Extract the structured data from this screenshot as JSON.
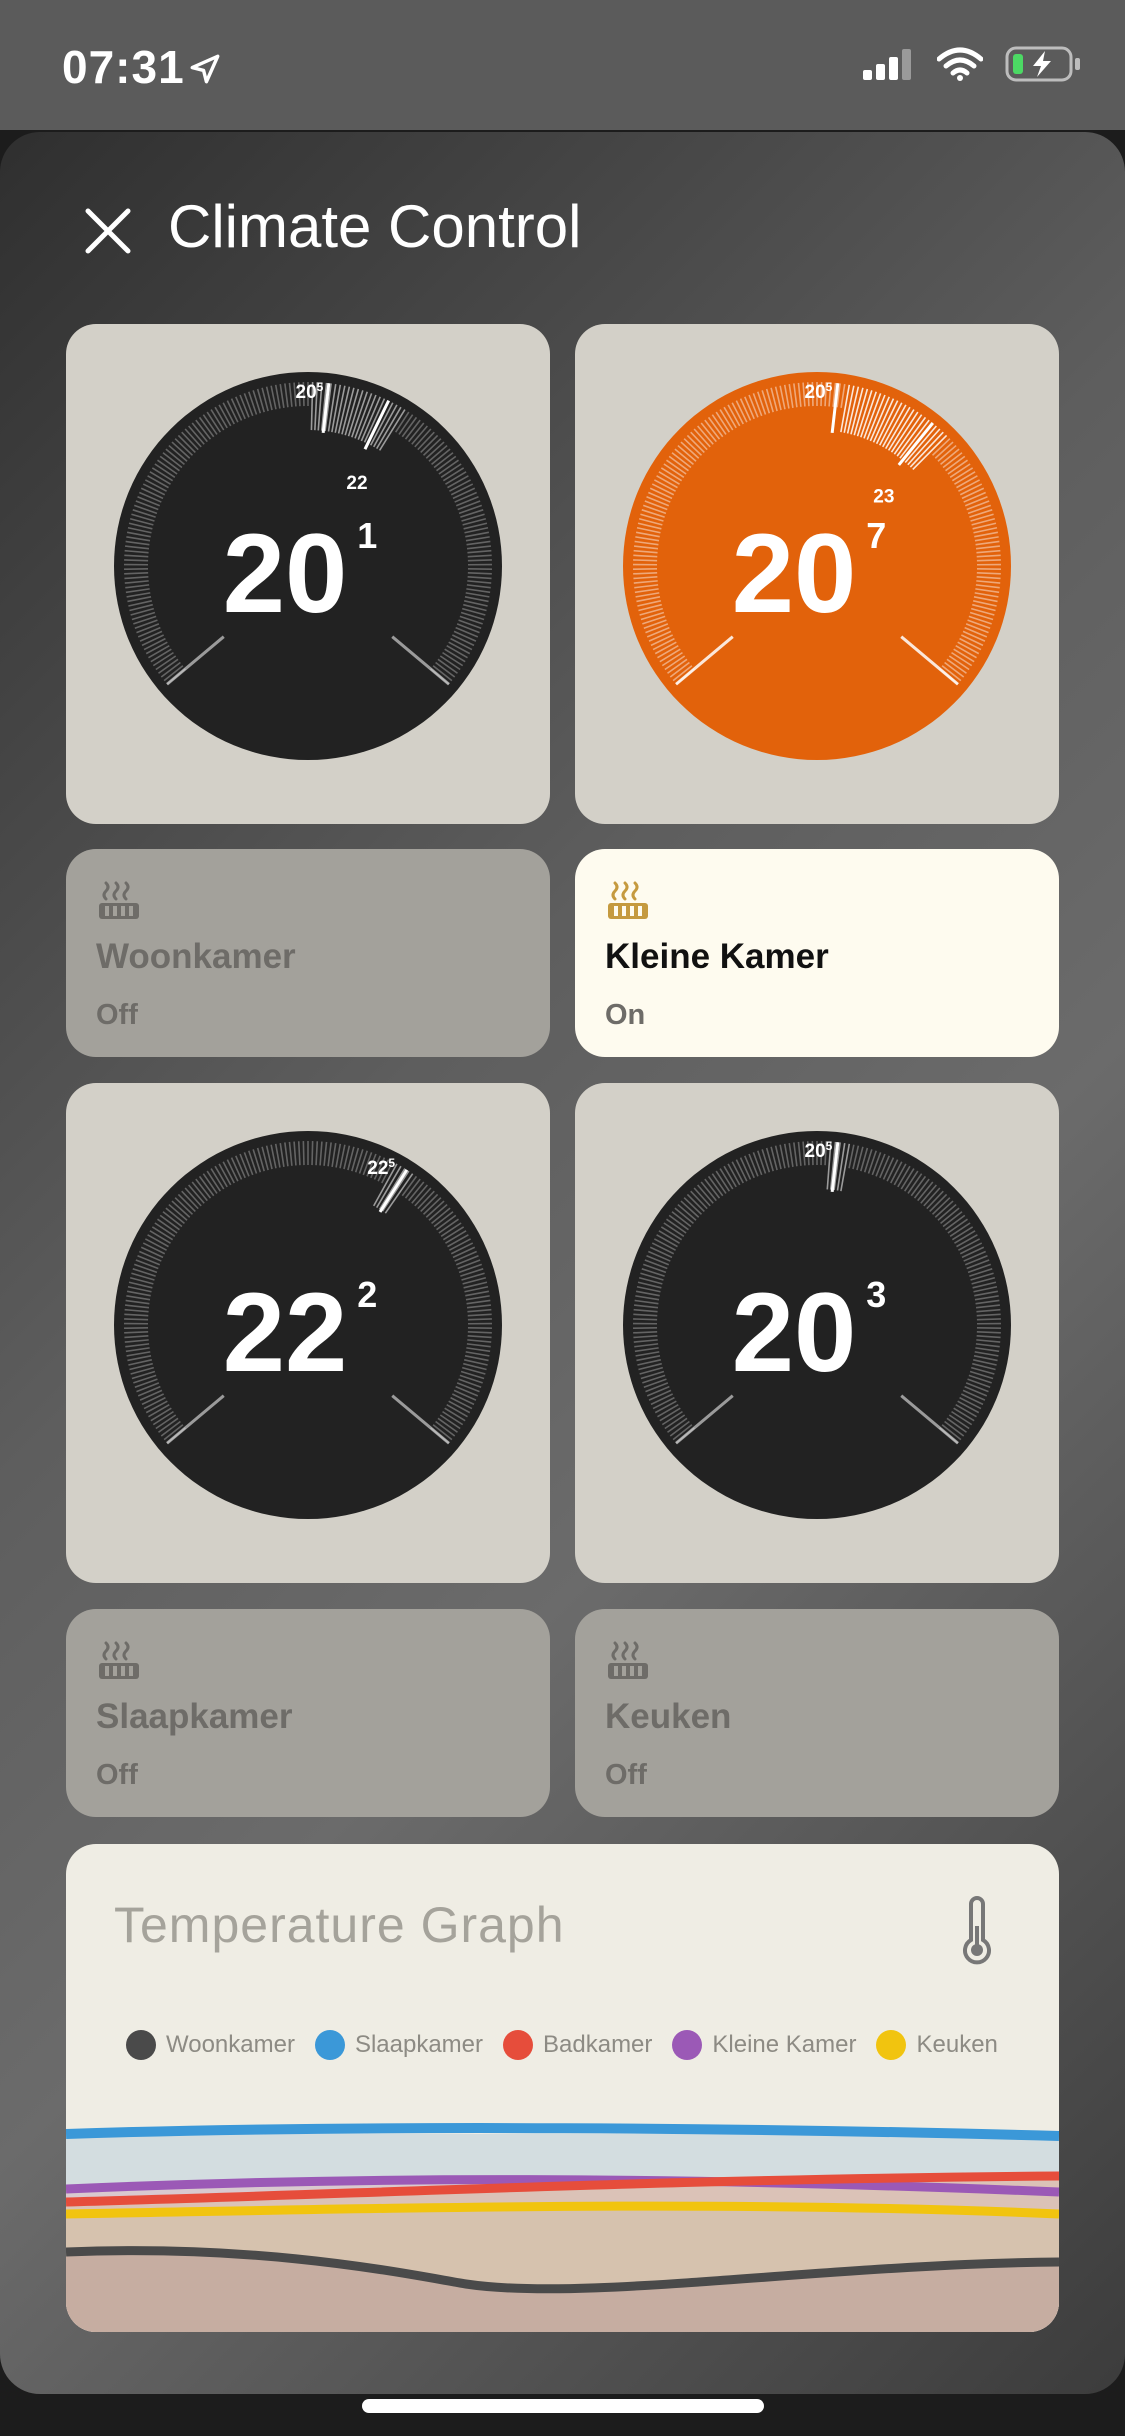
{
  "status": {
    "time": "07:31",
    "icons": [
      "location-arrow-icon",
      "cellular-signal-icon",
      "wifi-icon",
      "battery-charging-icon"
    ]
  },
  "sheet": {
    "title": "Climate Control",
    "close_icon": "close-icon"
  },
  "thermostats": [
    {
      "name": "Woonkamer",
      "current_int": "20",
      "current_dec": "1",
      "setpoint_int": "20",
      "setpoint_dec": "5",
      "target_label": "22",
      "active": false,
      "color": "#222222",
      "pointer_min": 20.1,
      "target_marker": 22
    },
    {
      "name": "Kleine Kamer",
      "current_int": "20",
      "current_dec": "7",
      "setpoint_int": "20",
      "setpoint_dec": "5",
      "target_label": "23",
      "active": true,
      "color": "#e2620b",
      "pointer_min": 20.7,
      "target_marker": 23
    },
    {
      "name": "Slaapkamer",
      "current_int": "22",
      "current_dec": "2",
      "setpoint_int": "22",
      "setpoint_dec": "5",
      "target_label": "",
      "active": false,
      "color": "#222222",
      "pointer_min": 22.2,
      "target_marker": null
    },
    {
      "name": "Keuken",
      "current_int": "20",
      "current_dec": "3",
      "setpoint_int": "20",
      "setpoint_dec": "5",
      "target_label": "",
      "active": false,
      "color": "#222222",
      "pointer_min": 20.3,
      "target_marker": null
    }
  ],
  "switches": [
    {
      "name": "Woonkamer",
      "state": "Off",
      "icon": "heater-icon"
    },
    {
      "name": "Kleine Kamer",
      "state": "On",
      "icon": "heater-icon"
    },
    {
      "name": "Slaapkamer",
      "state": "Off",
      "icon": "heater-icon"
    },
    {
      "name": "Keuken",
      "state": "Off",
      "icon": "heater-icon"
    }
  ],
  "graph": {
    "title": "Temperature Graph",
    "icon": "thermometer-icon",
    "legend": [
      {
        "name": "Woonkamer",
        "color": "#4a4a4a"
      },
      {
        "name": "Slaapkamer",
        "color": "#3b98d8"
      },
      {
        "name": "Badkamer",
        "color": "#e64d3b"
      },
      {
        "name": "Kleine Kamer",
        "color": "#9b59b6"
      },
      {
        "name": "Keuken",
        "color": "#f1c40f"
      }
    ]
  },
  "colors": {
    "accent_on": "#e2620b",
    "heater_on": "#c59a3f",
    "heater_off": "#6e6c68"
  }
}
